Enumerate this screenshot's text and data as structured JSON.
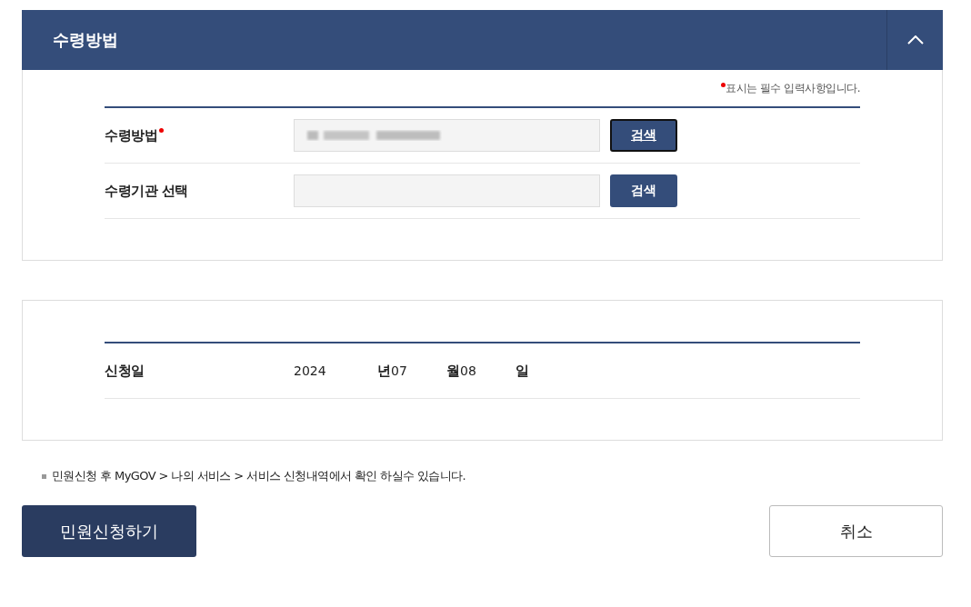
{
  "section": {
    "title": "수령방법",
    "expanded": true
  },
  "required_note": "표시는 필수 입력사항입니다.",
  "fields": [
    {
      "label": "수령방법",
      "required": true,
      "redacted": true,
      "button": {
        "label": "검색",
        "focused": true
      }
    },
    {
      "label": "수령기관 선택",
      "required": false,
      "redacted": false,
      "button": {
        "label": "검색",
        "focused": false
      }
    }
  ],
  "date_row": {
    "label": "신청일",
    "parts": [
      {
        "value": "2024",
        "unit": "년"
      },
      {
        "value": "07",
        "unit": "월"
      },
      {
        "value": "08",
        "unit": "일"
      }
    ]
  },
  "notice": "민원신청 후 MyGOV > 나의 서비스 > 서비스 신청내역에서 확인 하실수 있습니다.",
  "buttons": [
    {
      "label": "민원신청하기",
      "kind": "primary"
    },
    {
      "label": "취소",
      "kind": "secondary"
    }
  ]
}
